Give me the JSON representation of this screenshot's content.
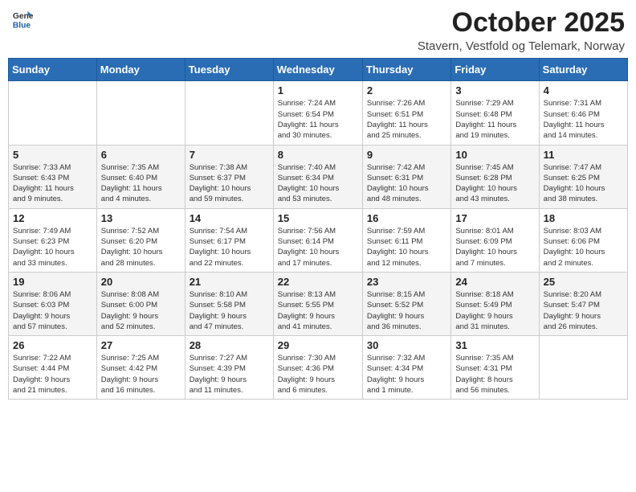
{
  "header": {
    "logo_general": "General",
    "logo_blue": "Blue",
    "title": "October 2025",
    "location": "Stavern, Vestfold og Telemark, Norway"
  },
  "weekdays": [
    "Sunday",
    "Monday",
    "Tuesday",
    "Wednesday",
    "Thursday",
    "Friday",
    "Saturday"
  ],
  "weeks": [
    [
      {
        "day": "",
        "info": ""
      },
      {
        "day": "",
        "info": ""
      },
      {
        "day": "",
        "info": ""
      },
      {
        "day": "1",
        "info": "Sunrise: 7:24 AM\nSunset: 6:54 PM\nDaylight: 11 hours\nand 30 minutes."
      },
      {
        "day": "2",
        "info": "Sunrise: 7:26 AM\nSunset: 6:51 PM\nDaylight: 11 hours\nand 25 minutes."
      },
      {
        "day": "3",
        "info": "Sunrise: 7:29 AM\nSunset: 6:48 PM\nDaylight: 11 hours\nand 19 minutes."
      },
      {
        "day": "4",
        "info": "Sunrise: 7:31 AM\nSunset: 6:46 PM\nDaylight: 11 hours\nand 14 minutes."
      }
    ],
    [
      {
        "day": "5",
        "info": "Sunrise: 7:33 AM\nSunset: 6:43 PM\nDaylight: 11 hours\nand 9 minutes."
      },
      {
        "day": "6",
        "info": "Sunrise: 7:35 AM\nSunset: 6:40 PM\nDaylight: 11 hours\nand 4 minutes."
      },
      {
        "day": "7",
        "info": "Sunrise: 7:38 AM\nSunset: 6:37 PM\nDaylight: 10 hours\nand 59 minutes."
      },
      {
        "day": "8",
        "info": "Sunrise: 7:40 AM\nSunset: 6:34 PM\nDaylight: 10 hours\nand 53 minutes."
      },
      {
        "day": "9",
        "info": "Sunrise: 7:42 AM\nSunset: 6:31 PM\nDaylight: 10 hours\nand 48 minutes."
      },
      {
        "day": "10",
        "info": "Sunrise: 7:45 AM\nSunset: 6:28 PM\nDaylight: 10 hours\nand 43 minutes."
      },
      {
        "day": "11",
        "info": "Sunrise: 7:47 AM\nSunset: 6:25 PM\nDaylight: 10 hours\nand 38 minutes."
      }
    ],
    [
      {
        "day": "12",
        "info": "Sunrise: 7:49 AM\nSunset: 6:23 PM\nDaylight: 10 hours\nand 33 minutes."
      },
      {
        "day": "13",
        "info": "Sunrise: 7:52 AM\nSunset: 6:20 PM\nDaylight: 10 hours\nand 28 minutes."
      },
      {
        "day": "14",
        "info": "Sunrise: 7:54 AM\nSunset: 6:17 PM\nDaylight: 10 hours\nand 22 minutes."
      },
      {
        "day": "15",
        "info": "Sunrise: 7:56 AM\nSunset: 6:14 PM\nDaylight: 10 hours\nand 17 minutes."
      },
      {
        "day": "16",
        "info": "Sunrise: 7:59 AM\nSunset: 6:11 PM\nDaylight: 10 hours\nand 12 minutes."
      },
      {
        "day": "17",
        "info": "Sunrise: 8:01 AM\nSunset: 6:09 PM\nDaylight: 10 hours\nand 7 minutes."
      },
      {
        "day": "18",
        "info": "Sunrise: 8:03 AM\nSunset: 6:06 PM\nDaylight: 10 hours\nand 2 minutes."
      }
    ],
    [
      {
        "day": "19",
        "info": "Sunrise: 8:06 AM\nSunset: 6:03 PM\nDaylight: 9 hours\nand 57 minutes."
      },
      {
        "day": "20",
        "info": "Sunrise: 8:08 AM\nSunset: 6:00 PM\nDaylight: 9 hours\nand 52 minutes."
      },
      {
        "day": "21",
        "info": "Sunrise: 8:10 AM\nSunset: 5:58 PM\nDaylight: 9 hours\nand 47 minutes."
      },
      {
        "day": "22",
        "info": "Sunrise: 8:13 AM\nSunset: 5:55 PM\nDaylight: 9 hours\nand 41 minutes."
      },
      {
        "day": "23",
        "info": "Sunrise: 8:15 AM\nSunset: 5:52 PM\nDaylight: 9 hours\nand 36 minutes."
      },
      {
        "day": "24",
        "info": "Sunrise: 8:18 AM\nSunset: 5:49 PM\nDaylight: 9 hours\nand 31 minutes."
      },
      {
        "day": "25",
        "info": "Sunrise: 8:20 AM\nSunset: 5:47 PM\nDaylight: 9 hours\nand 26 minutes."
      }
    ],
    [
      {
        "day": "26",
        "info": "Sunrise: 7:22 AM\nSunset: 4:44 PM\nDaylight: 9 hours\nand 21 minutes."
      },
      {
        "day": "27",
        "info": "Sunrise: 7:25 AM\nSunset: 4:42 PM\nDaylight: 9 hours\nand 16 minutes."
      },
      {
        "day": "28",
        "info": "Sunrise: 7:27 AM\nSunset: 4:39 PM\nDaylight: 9 hours\nand 11 minutes."
      },
      {
        "day": "29",
        "info": "Sunrise: 7:30 AM\nSunset: 4:36 PM\nDaylight: 9 hours\nand 6 minutes."
      },
      {
        "day": "30",
        "info": "Sunrise: 7:32 AM\nSunset: 4:34 PM\nDaylight: 9 hours\nand 1 minute."
      },
      {
        "day": "31",
        "info": "Sunrise: 7:35 AM\nSunset: 4:31 PM\nDaylight: 8 hours\nand 56 minutes."
      },
      {
        "day": "",
        "info": ""
      }
    ]
  ]
}
